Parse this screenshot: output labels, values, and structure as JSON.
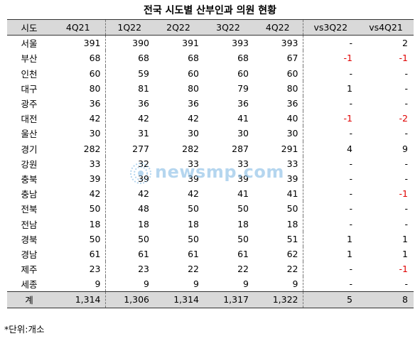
{
  "title": "전국 시도별 산부인과 의원 현황",
  "headers": [
    "시도",
    "4Q21",
    "1Q22",
    "2Q22",
    "3Q22",
    "4Q22",
    "vs3Q22",
    "vs4Q21"
  ],
  "rows": [
    {
      "region": "서울",
      "values": [
        "391",
        "390",
        "391",
        "393",
        "393"
      ],
      "vs3": "-",
      "vs4": "2"
    },
    {
      "region": "부산",
      "values": [
        "68",
        "68",
        "68",
        "68",
        "67"
      ],
      "vs3": "-1",
      "vs4": "-1"
    },
    {
      "region": "인천",
      "values": [
        "60",
        "59",
        "60",
        "60",
        "60"
      ],
      "vs3": "-",
      "vs4": "-"
    },
    {
      "region": "대구",
      "values": [
        "80",
        "81",
        "80",
        "79",
        "80"
      ],
      "vs3": "1",
      "vs4": "-"
    },
    {
      "region": "광주",
      "values": [
        "36",
        "36",
        "36",
        "36",
        "36"
      ],
      "vs3": "-",
      "vs4": "-"
    },
    {
      "region": "대전",
      "values": [
        "42",
        "42",
        "42",
        "41",
        "40"
      ],
      "vs3": "-1",
      "vs4": "-2"
    },
    {
      "region": "울산",
      "values": [
        "30",
        "31",
        "30",
        "30",
        "30"
      ],
      "vs3": "-",
      "vs4": "-"
    },
    {
      "region": "경기",
      "values": [
        "282",
        "277",
        "282",
        "287",
        "291"
      ],
      "vs3": "4",
      "vs4": "9"
    },
    {
      "region": "강원",
      "values": [
        "33",
        "32",
        "33",
        "33",
        "33"
      ],
      "vs3": "-",
      "vs4": "-"
    },
    {
      "region": "충북",
      "values": [
        "39",
        "39",
        "39",
        "39",
        "39"
      ],
      "vs3": "-",
      "vs4": "-"
    },
    {
      "region": "충남",
      "values": [
        "42",
        "42",
        "42",
        "41",
        "41"
      ],
      "vs3": "-",
      "vs4": "-1"
    },
    {
      "region": "전북",
      "values": [
        "50",
        "48",
        "50",
        "50",
        "50"
      ],
      "vs3": "-",
      "vs4": "-"
    },
    {
      "region": "전남",
      "values": [
        "18",
        "18",
        "18",
        "18",
        "18"
      ],
      "vs3": "-",
      "vs4": "-"
    },
    {
      "region": "경북",
      "values": [
        "50",
        "50",
        "50",
        "50",
        "51"
      ],
      "vs3": "1",
      "vs4": "1"
    },
    {
      "region": "경남",
      "values": [
        "61",
        "61",
        "61",
        "61",
        "62"
      ],
      "vs3": "1",
      "vs4": "1"
    },
    {
      "region": "제주",
      "values": [
        "23",
        "23",
        "22",
        "22",
        "22"
      ],
      "vs3": "-",
      "vs4": "-1"
    },
    {
      "region": "세종",
      "values": [
        "9",
        "9",
        "9",
        "9",
        "9"
      ],
      "vs3": "-",
      "vs4": "-"
    }
  ],
  "total": {
    "region": "계",
    "values": [
      "1,314",
      "1,306",
      "1,314",
      "1,317",
      "1,322"
    ],
    "vs3": "5",
    "vs4": "8"
  },
  "note": "*단위:개소",
  "watermark": "newsmp.com",
  "colors": {
    "header_bg": "#d9d9d9",
    "negative": "#e00000",
    "watermark": "#78b4e1"
  }
}
